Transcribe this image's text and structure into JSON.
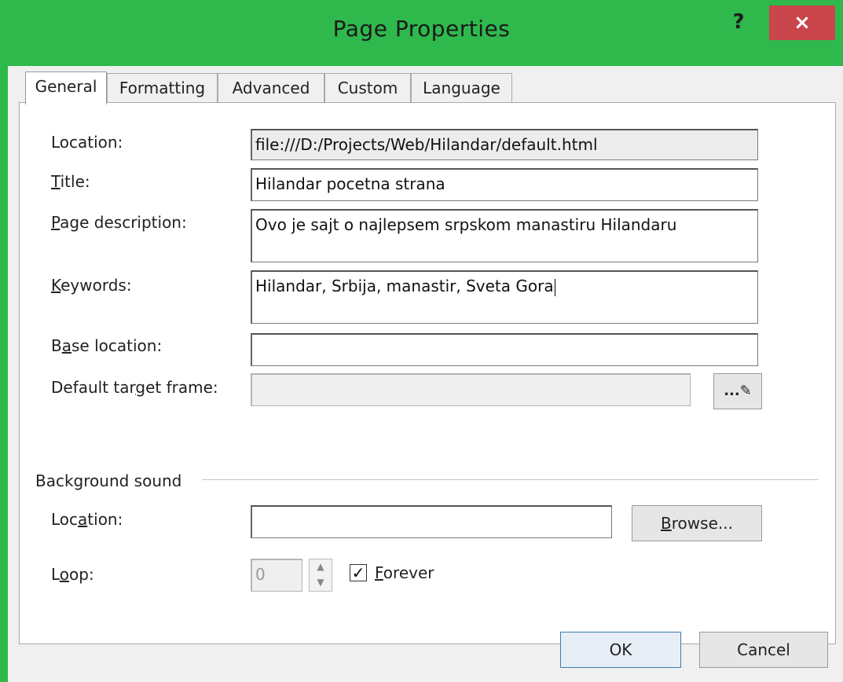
{
  "window": {
    "title": "Page Properties",
    "help_label": "?",
    "close_label": "×"
  },
  "tabs": [
    {
      "label": "General",
      "active": true
    },
    {
      "label": "Formatting",
      "active": false
    },
    {
      "label": "Advanced",
      "active": false
    },
    {
      "label": "Custom",
      "active": false
    },
    {
      "label": "Language",
      "active": false
    }
  ],
  "general": {
    "location": {
      "label": "Location:",
      "value": "file:///D:/Projects/Web/Hilandar/default.html"
    },
    "title": {
      "label_pre": "",
      "label_key": "T",
      "label_post": "itle:",
      "value": "Hilandar pocetna strana"
    },
    "page_description": {
      "label_pre": "",
      "label_key": "P",
      "label_post": "age description:",
      "value": "Ovo je sajt o najlepsem srpskom manastiru Hilandaru"
    },
    "keywords": {
      "label_pre": "",
      "label_key": "K",
      "label_post": "eywords:",
      "value": "Hilandar, Srbija, manastir, Sveta Gora"
    },
    "base_location": {
      "label_pre": "B",
      "label_key": "a",
      "label_post": "se location:",
      "value": ""
    },
    "default_target_frame": {
      "label_pre": "Default tar",
      "label_key": "g",
      "label_post": "et frame:",
      "value": "",
      "button_label": "...✎"
    }
  },
  "background_sound": {
    "group_label": "Background sound",
    "location": {
      "label_pre": "Loc",
      "label_key": "a",
      "label_post": "tion:",
      "value": ""
    },
    "browse_label_key": "B",
    "browse_label_post": "rowse...",
    "loop": {
      "label_pre": "L",
      "label_key": "o",
      "label_post": "op:",
      "value": "0"
    },
    "forever": {
      "checked": true,
      "label_key": "F",
      "label_post": "orever"
    }
  },
  "footer": {
    "ok_label": "OK",
    "cancel_label": "Cancel"
  },
  "colors": {
    "title_bar": "#2fb84c",
    "close_button": "#c9454b"
  }
}
